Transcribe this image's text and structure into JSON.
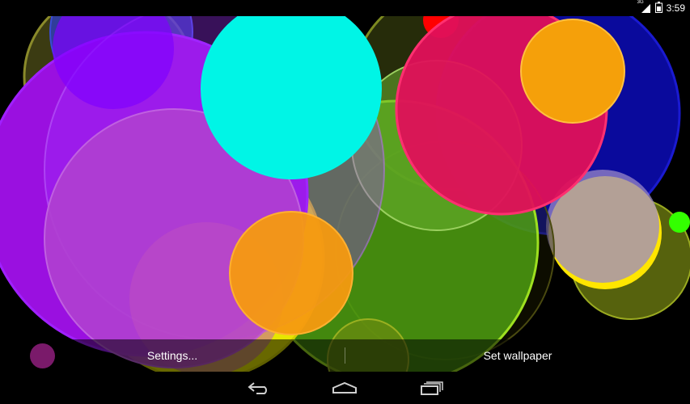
{
  "status_bar": {
    "network_label": "3G",
    "time": "3:59",
    "icons": [
      "signal-icon",
      "battery-icon"
    ]
  },
  "action_bar": {
    "settings_label": "Settings...",
    "set_wallpaper_label": "Set wallpaper"
  },
  "nav_bar": {
    "buttons": [
      "back-icon",
      "home-icon",
      "recent-apps-icon"
    ]
  },
  "colors": {
    "accent_dot": "#7a1a6a",
    "nav_icon": "#cfcfcf"
  }
}
